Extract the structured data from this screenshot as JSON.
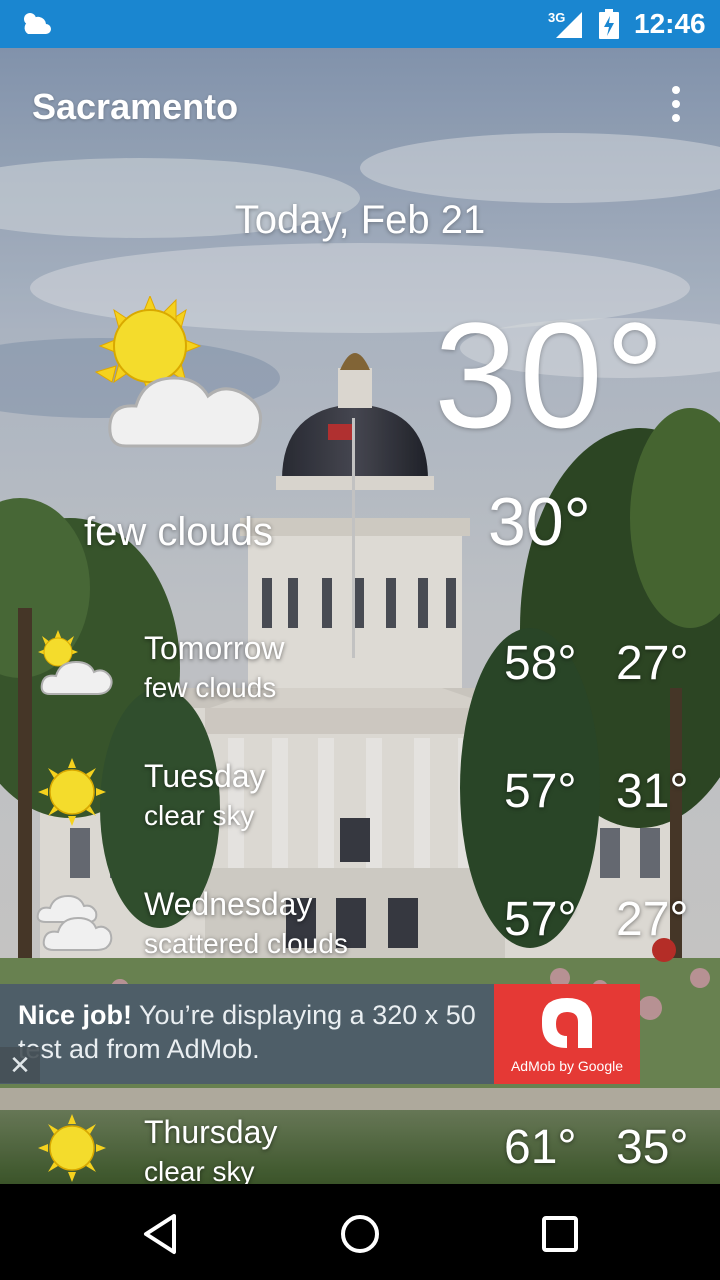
{
  "status_bar": {
    "network_label": "3G",
    "time": "12:46"
  },
  "app": {
    "city": "Sacramento"
  },
  "today": {
    "date": "Today, Feb 21",
    "temp": "30°",
    "low": "30°",
    "description": "few clouds",
    "icon": "sun-cloud-icon"
  },
  "forecast": [
    {
      "day": "Tomorrow",
      "description": "few clouds",
      "high": "58°",
      "low": "27°",
      "icon": "sun-cloud-icon"
    },
    {
      "day": "Tuesday",
      "description": "clear sky",
      "high": "57°",
      "low": "31°",
      "icon": "sun-icon"
    },
    {
      "day": "Wednesday",
      "description": "scattered clouds",
      "high": "57°",
      "low": "27°",
      "icon": "clouds-icon"
    },
    {
      "day": "Thursday",
      "description": "clear sky",
      "high": "61°",
      "low": "35°",
      "icon": "sun-icon"
    }
  ],
  "ad": {
    "headline": "Nice job!",
    "body": " You’re displaying a 320 x 50 test ad from AdMob.",
    "logo_caption": "AdMob by Google",
    "close_label": "✕"
  },
  "colors": {
    "status_bar": "#1a86d0",
    "ad_background": "#4e5e68",
    "ad_logo": "#e53935"
  }
}
